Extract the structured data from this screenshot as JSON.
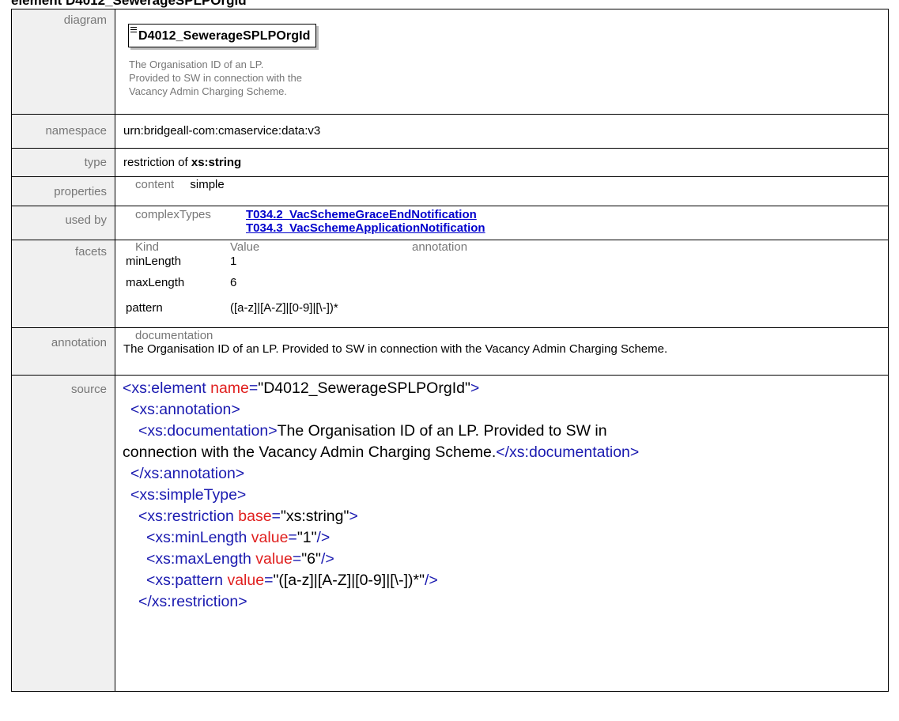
{
  "page": {
    "title": "element D4012_SewerageSPLPOrgId"
  },
  "rows": {
    "diagram": {
      "label": "diagram",
      "box_name": "D4012_SewerageSPLPOrgId",
      "doc_lines": [
        "The Organisation ID of an LP.",
        "Provided to SW in connection with the",
        "Vacancy Admin Charging Scheme."
      ]
    },
    "namespace": {
      "label": "namespace",
      "value": "urn:bridgeall-com:cmaservice:data:v3"
    },
    "type": {
      "label": "type",
      "prefix": "restriction of ",
      "base": "xs:string"
    },
    "properties": {
      "label": "properties",
      "key": "content",
      "value": "simple"
    },
    "used_by": {
      "label": "used by",
      "key": "complexTypes",
      "links": [
        "T034.2_VacSchemeGraceEndNotification",
        "T034.3_VacSchemeApplicationNotification"
      ]
    },
    "facets": {
      "label": "facets",
      "headers": [
        "Kind",
        "Value",
        "annotation"
      ],
      "items": [
        {
          "kind": "minLength",
          "value": "1"
        },
        {
          "kind": "maxLength",
          "value": "6"
        },
        {
          "kind": "pattern",
          "value": "([a-z]|[A-Z]|[0-9]|[\\-])*"
        }
      ]
    },
    "annotation": {
      "label": "annotation",
      "key": "documentation",
      "text": "The Organisation ID of an LP. Provided to SW in connection with the Vacancy Admin Charging Scheme."
    },
    "source": {
      "label": "source"
    }
  },
  "source_code": {
    "el_open": "<xs:element",
    "name_attr": "name",
    "name_val": "\"D4012_SewerageSPLPOrgId\"",
    "close_gt": ">",
    "annot_open": "<xs:annotation>",
    "doc_open": "<xs:documentation>",
    "doc_text_1": "The Organisation ID of an LP. Provided to SW in",
    "doc_text_2": "connection with the Vacancy Admin Charging Scheme.",
    "doc_close": "</xs:documentation>",
    "annot_close": "</xs:annotation>",
    "st_open": "<xs:simpleType>",
    "restr_open": "<xs:restriction",
    "base_attr": "base",
    "base_val": "\"xs:string\"",
    "minlen_tag": "<xs:minLength",
    "minlen_attr": "value",
    "minlen_val": "\"1\"",
    "maxlen_tag": "<xs:maxLength",
    "maxlen_attr": "value",
    "maxlen_val": "\"6\"",
    "pattern_tag": "<xs:pattern",
    "pattern_attr": "value",
    "pattern_val": "\"([a-z]|[A-Z]|[0-9]|[\\-])*\"",
    "eq": "=",
    "self_close": "/>",
    "restr_close": "</xs:restriction>"
  }
}
